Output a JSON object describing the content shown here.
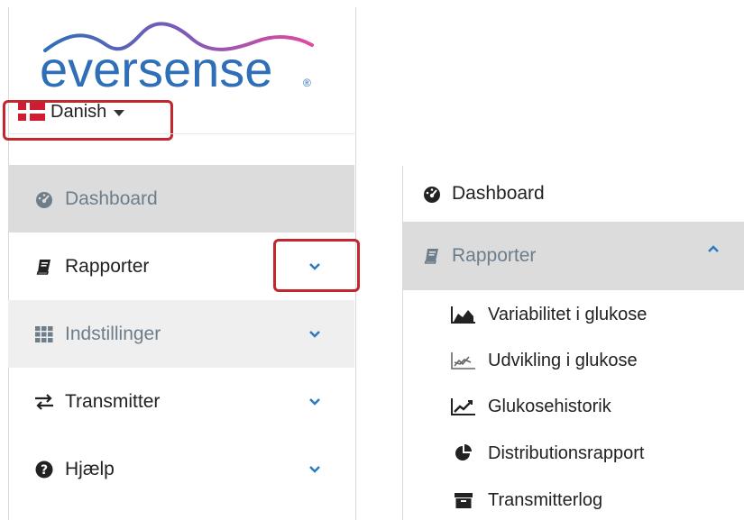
{
  "logo": {
    "text": "eversense",
    "registered": "®",
    "colors": [
      "#2e6fb8",
      "#7a5bb6",
      "#e04aa0"
    ]
  },
  "language": {
    "selected": "Danish"
  },
  "left_nav": {
    "items": [
      {
        "label": "Dashboard",
        "icon": "dashboard-icon",
        "state": "active"
      },
      {
        "label": "Rapporter",
        "icon": "book-icon",
        "state": "normal",
        "expandable": true
      },
      {
        "label": "Indstillinger",
        "icon": "grid-icon",
        "state": "muted",
        "expandable": true
      },
      {
        "label": "Transmitter",
        "icon": "exchange-icon",
        "state": "normal",
        "expandable": true
      },
      {
        "label": "Hjælp",
        "icon": "question-icon",
        "state": "normal",
        "expandable": true
      }
    ]
  },
  "right_nav": {
    "dashboard": {
      "label": "Dashboard",
      "icon": "dashboard-icon"
    },
    "reports": {
      "label": "Rapporter",
      "icon": "book-icon",
      "expanded": true
    },
    "sub_items": [
      {
        "label": "Variabilitet i glukose",
        "icon": "area-chart-icon"
      },
      {
        "label": "Udvikling i glukose",
        "icon": "trend-chart-icon"
      },
      {
        "label": "Glukosehistorik",
        "icon": "line-chart-icon"
      },
      {
        "label": "Distributionsrapport",
        "icon": "pie-chart-icon"
      },
      {
        "label": "Transmitterlog",
        "icon": "archive-icon"
      }
    ]
  },
  "colors": {
    "highlight": "#c1272d",
    "chevron": "#2b7bc0",
    "active_bg": "#dcdcdc",
    "muted_text": "#6e7d8a"
  }
}
